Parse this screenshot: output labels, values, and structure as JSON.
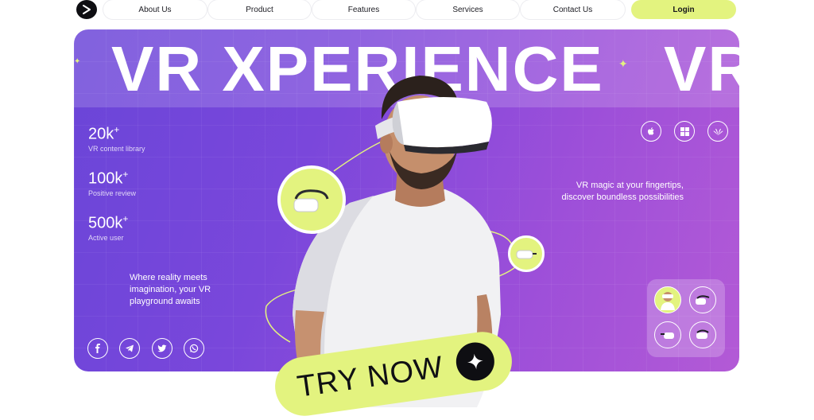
{
  "nav": {
    "items": [
      {
        "label": "About Us"
      },
      {
        "label": "Product"
      },
      {
        "label": "Features"
      },
      {
        "label": "Services"
      },
      {
        "label": "Contact Us"
      }
    ],
    "login_label": "Login"
  },
  "hero": {
    "title": "VR XPERIENCE",
    "title_repeat": "VR",
    "stats": [
      {
        "value": "20k",
        "suffix": "+",
        "label": "VR content library"
      },
      {
        "value": "100k",
        "suffix": "+",
        "label": "Positive review"
      },
      {
        "value": "500k",
        "suffix": "+",
        "label": "Active user"
      }
    ],
    "tagline_left": "Where reality meets imagination, your VR playground awaits",
    "tagline_right": "VR magic at your fingertips, discover boundless possibilities",
    "cta_label": "TRY NOW",
    "social_icons": [
      "facebook-icon",
      "telegram-icon",
      "twitter-icon",
      "whatsapp-icon"
    ],
    "platform_icons": [
      "apple-icon",
      "windows-icon",
      "huawei-icon"
    ]
  },
  "colors": {
    "accent": "#e3f37f",
    "hero_start": "#6a45d8",
    "hero_end": "#b35ad6",
    "dark": "#0e0e12"
  }
}
